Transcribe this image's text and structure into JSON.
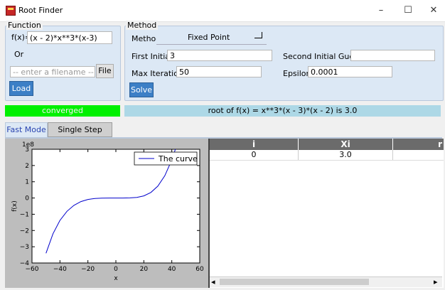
{
  "window": {
    "title": "Root Finder",
    "controls": {
      "minimize": "–",
      "maximize": "☐",
      "close": "✕"
    }
  },
  "function_panel": {
    "title": "Function",
    "fx_label": "f(x)=",
    "fx_value": "(x - 2)*x**3*(x-3)",
    "or_label": "Or",
    "filename_placeholder": "-- enter a filename --",
    "file_button": "File",
    "load_button": "Load"
  },
  "method_panel": {
    "title": "Method",
    "method_label": "Method",
    "method_value": "Fixed Point",
    "first_guess_label": "First Initial Guess",
    "first_guess_value": "3",
    "second_guess_label": "Second Initial Guess",
    "second_guess_value": "",
    "max_iter_label": "Max Iterations",
    "max_iter_value": "50",
    "epsilon_label": "Epsilon",
    "epsilon_value": "0.0001",
    "solve_button": "Solve"
  },
  "status": {
    "state": "converged",
    "result": "root of f(x) = x**3*(x - 3)*(x - 2) is 3.0"
  },
  "tabs": [
    {
      "label": "Fast Mode",
      "active": true
    },
    {
      "label": "Single Step Mode",
      "active": false
    }
  ],
  "plot": {
    "scale_label": "1e8",
    "ylabel": "f(x)",
    "xlabel": "x",
    "legend": "The curve",
    "line_color": "#0000cc"
  },
  "chart_data": {
    "type": "line",
    "series": [
      {
        "name": "The curve",
        "x": [
          -50,
          -45,
          -40,
          -35,
          -30,
          -25,
          -20,
          -15,
          -10,
          -5,
          0,
          5,
          10,
          15,
          20,
          25,
          30,
          35,
          40,
          42,
          44,
          45
        ],
        "y": [
          -3.4,
          -2.2,
          -1.38,
          -0.82,
          -0.45,
          -0.22,
          -0.09,
          -0.03,
          -0.01,
          -0.001,
          0,
          0.0,
          0.006,
          0.04,
          0.13,
          0.34,
          0.73,
          1.37,
          2.35,
          2.85,
          3.4,
          3.7
        ]
      }
    ],
    "xlim": [
      -60,
      60
    ],
    "ylim": [
      -4,
      3
    ],
    "xticks": [
      -60,
      -40,
      -20,
      0,
      20,
      40,
      60
    ],
    "yticks": [
      -4,
      -3,
      -2,
      -1,
      0,
      1,
      2,
      3
    ],
    "xlabel": "x",
    "ylabel": "f(x)",
    "legend_position": "top-right"
  },
  "table": {
    "columns": [
      "i",
      "Xi",
      "r"
    ],
    "rows": [
      [
        "0",
        "3.0",
        ""
      ]
    ]
  },
  "scrollbar": {
    "left_arrow": "◂",
    "right_arrow": "▸"
  }
}
